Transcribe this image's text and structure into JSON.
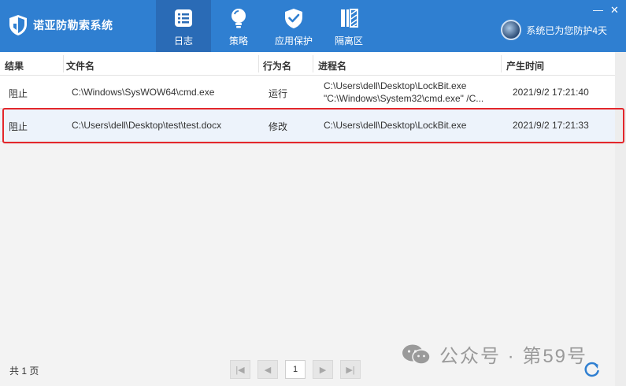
{
  "app": {
    "title": "诺亚防勒索系统"
  },
  "nav": [
    {
      "label": "日志",
      "icon": "log-list-icon",
      "active": true
    },
    {
      "label": "策略",
      "icon": "lightbulb-icon",
      "active": false
    },
    {
      "label": "应用保护",
      "icon": "shield-check-icon",
      "active": false
    },
    {
      "label": "隔离区",
      "icon": "isolation-zone-icon",
      "active": false
    }
  ],
  "window": {
    "min_glyph": "—",
    "close_glyph": "✕"
  },
  "status": {
    "text": "系统已为您防护4天"
  },
  "table": {
    "headers": {
      "result": "结果",
      "file": "文件名",
      "action": "行为名",
      "process": "进程名",
      "time": "产生时间"
    },
    "rows": [
      {
        "result": "阻止",
        "file": "C:\\Windows\\SysWOW64\\cmd.exe",
        "action": "运行",
        "process_line1": "C:\\Users\\dell\\Desktop\\LockBit.exe",
        "process_line2": "\"C:\\Windows\\System32\\cmd.exe\"  /C...",
        "time": "2021/9/2 17:21:40"
      },
      {
        "result": "阻止",
        "file": "C:\\Users\\dell\\Desktop\\test\\test.docx",
        "action": "修改",
        "process_line1": "C:\\Users\\dell\\Desktop\\LockBit.exe",
        "process_line2": "",
        "time": "2021/9/2 17:21:33",
        "selected": true
      }
    ]
  },
  "footer": {
    "page_count": "共 1 页",
    "pager": {
      "first": "|◀",
      "prev": "◀",
      "current": "1",
      "next": "▶",
      "last": "▶|"
    },
    "watermark": "公众号 · 第59号"
  },
  "colors": {
    "header": "#2f7fd1",
    "active_nav": "#2a6bb6",
    "highlight": "#e3262b",
    "refresh": "#2f7fd1"
  }
}
